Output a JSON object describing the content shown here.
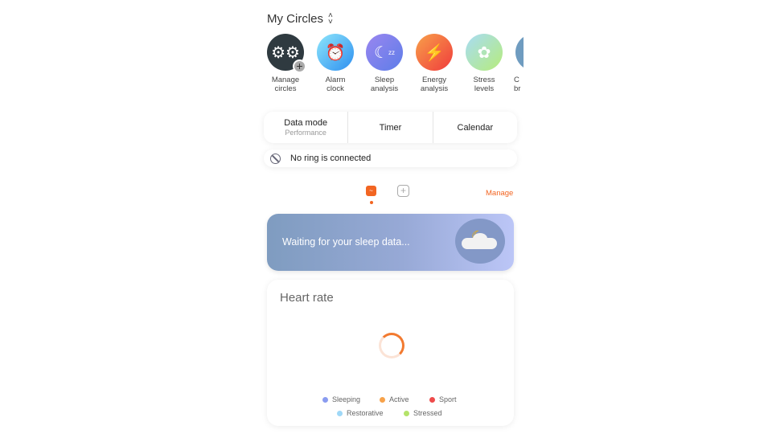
{
  "header": {
    "title": "My Circles"
  },
  "circles": [
    {
      "label": [
        "Manage",
        "circles"
      ],
      "icon": "gears-icon"
    },
    {
      "label": [
        "Alarm",
        "clock"
      ],
      "icon": "alarm-clock-icon"
    },
    {
      "label": [
        "Sleep",
        "analysis"
      ],
      "icon": "moon-icon"
    },
    {
      "label": [
        "Energy",
        "analysis"
      ],
      "icon": "lightning-icon"
    },
    {
      "label": [
        "Stress",
        "levels"
      ],
      "icon": "brain-icon"
    },
    {
      "label": [
        "C",
        "br"
      ],
      "icon": "partial-icon"
    }
  ],
  "modes": {
    "data_mode": "Data mode",
    "data_mode_value": "Performance",
    "timer": "Timer",
    "calendar": "Calendar"
  },
  "ring_status": "No ring is connected",
  "manage": "Manage",
  "sleep_banner": "Waiting for your sleep data...",
  "heart_rate": {
    "title": "Heart rate",
    "legend": [
      {
        "label": "Sleeping",
        "color": "#8a9cf0"
      },
      {
        "label": "Active",
        "color": "#f7a24a"
      },
      {
        "label": "Sport",
        "color": "#ee4b4b"
      },
      {
        "label": "Restorative",
        "color": "#9fd8f7"
      },
      {
        "label": "Stressed",
        "color": "#b4e36a"
      }
    ]
  },
  "colors": {
    "accent": "#f26522"
  }
}
